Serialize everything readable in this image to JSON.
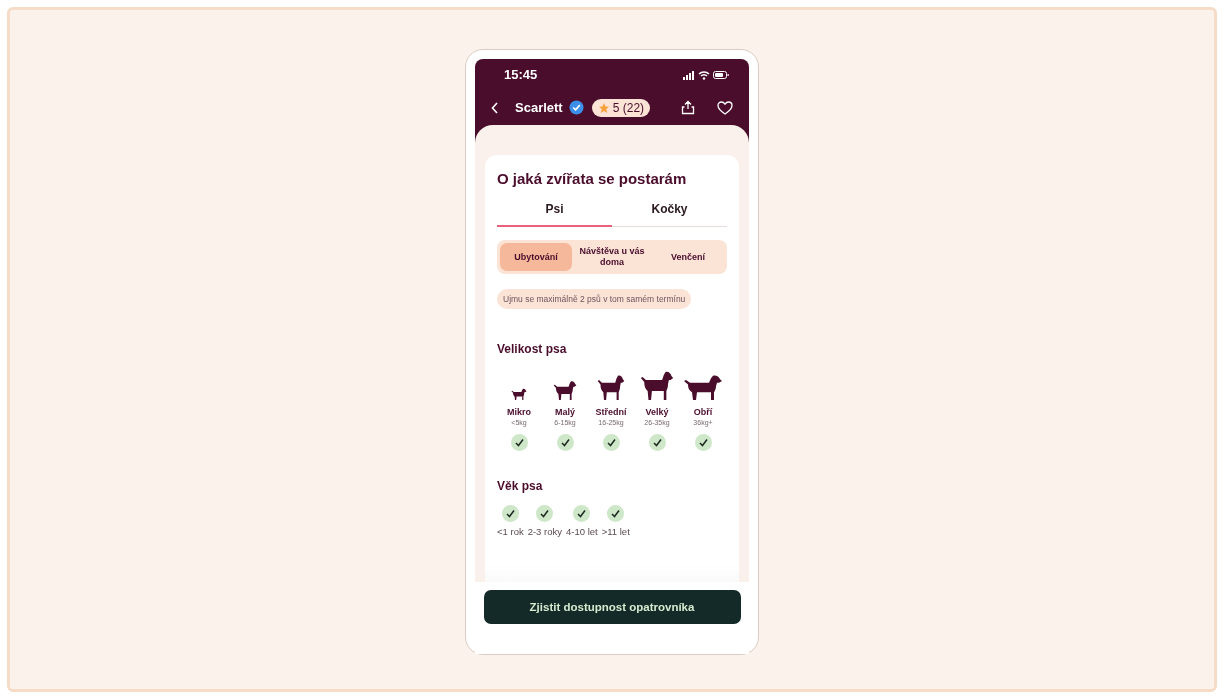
{
  "status_bar": {
    "time": "15:45"
  },
  "header": {
    "name": "Scarlett",
    "verified": true,
    "rating": "5 (22)"
  },
  "section": {
    "title": "O jaká zvířata se postarám",
    "tabs": [
      {
        "label": "Psi",
        "selected": true
      },
      {
        "label": "Kočky",
        "selected": false
      }
    ],
    "services": [
      {
        "label": "Ubytování",
        "selected": true
      },
      {
        "label": "Návštěva u vás doma",
        "selected": false
      },
      {
        "label": "Venčení",
        "selected": false
      }
    ],
    "note": "Ujmu se maximálně 2 psů v tom samém termínu",
    "size_title": "Velikost psa",
    "sizes": [
      {
        "name": "Mikro",
        "weight": "<5kg",
        "checked": true
      },
      {
        "name": "Malý",
        "weight": "6-15kg",
        "checked": true
      },
      {
        "name": "Střední",
        "weight": "16-25kg",
        "checked": true
      },
      {
        "name": "Velký",
        "weight": "26-35kg",
        "checked": true
      },
      {
        "name": "Obří",
        "weight": "36kg+",
        "checked": true
      }
    ],
    "age_title": "Věk psa",
    "ages": [
      {
        "label": "<1 rok",
        "checked": true
      },
      {
        "label": "2-3 roky",
        "checked": true
      },
      {
        "label": "4-10 let",
        "checked": true
      },
      {
        "label": ">11 let",
        "checked": true
      }
    ]
  },
  "button": "Zjistit dostupnost opatrovníka"
}
